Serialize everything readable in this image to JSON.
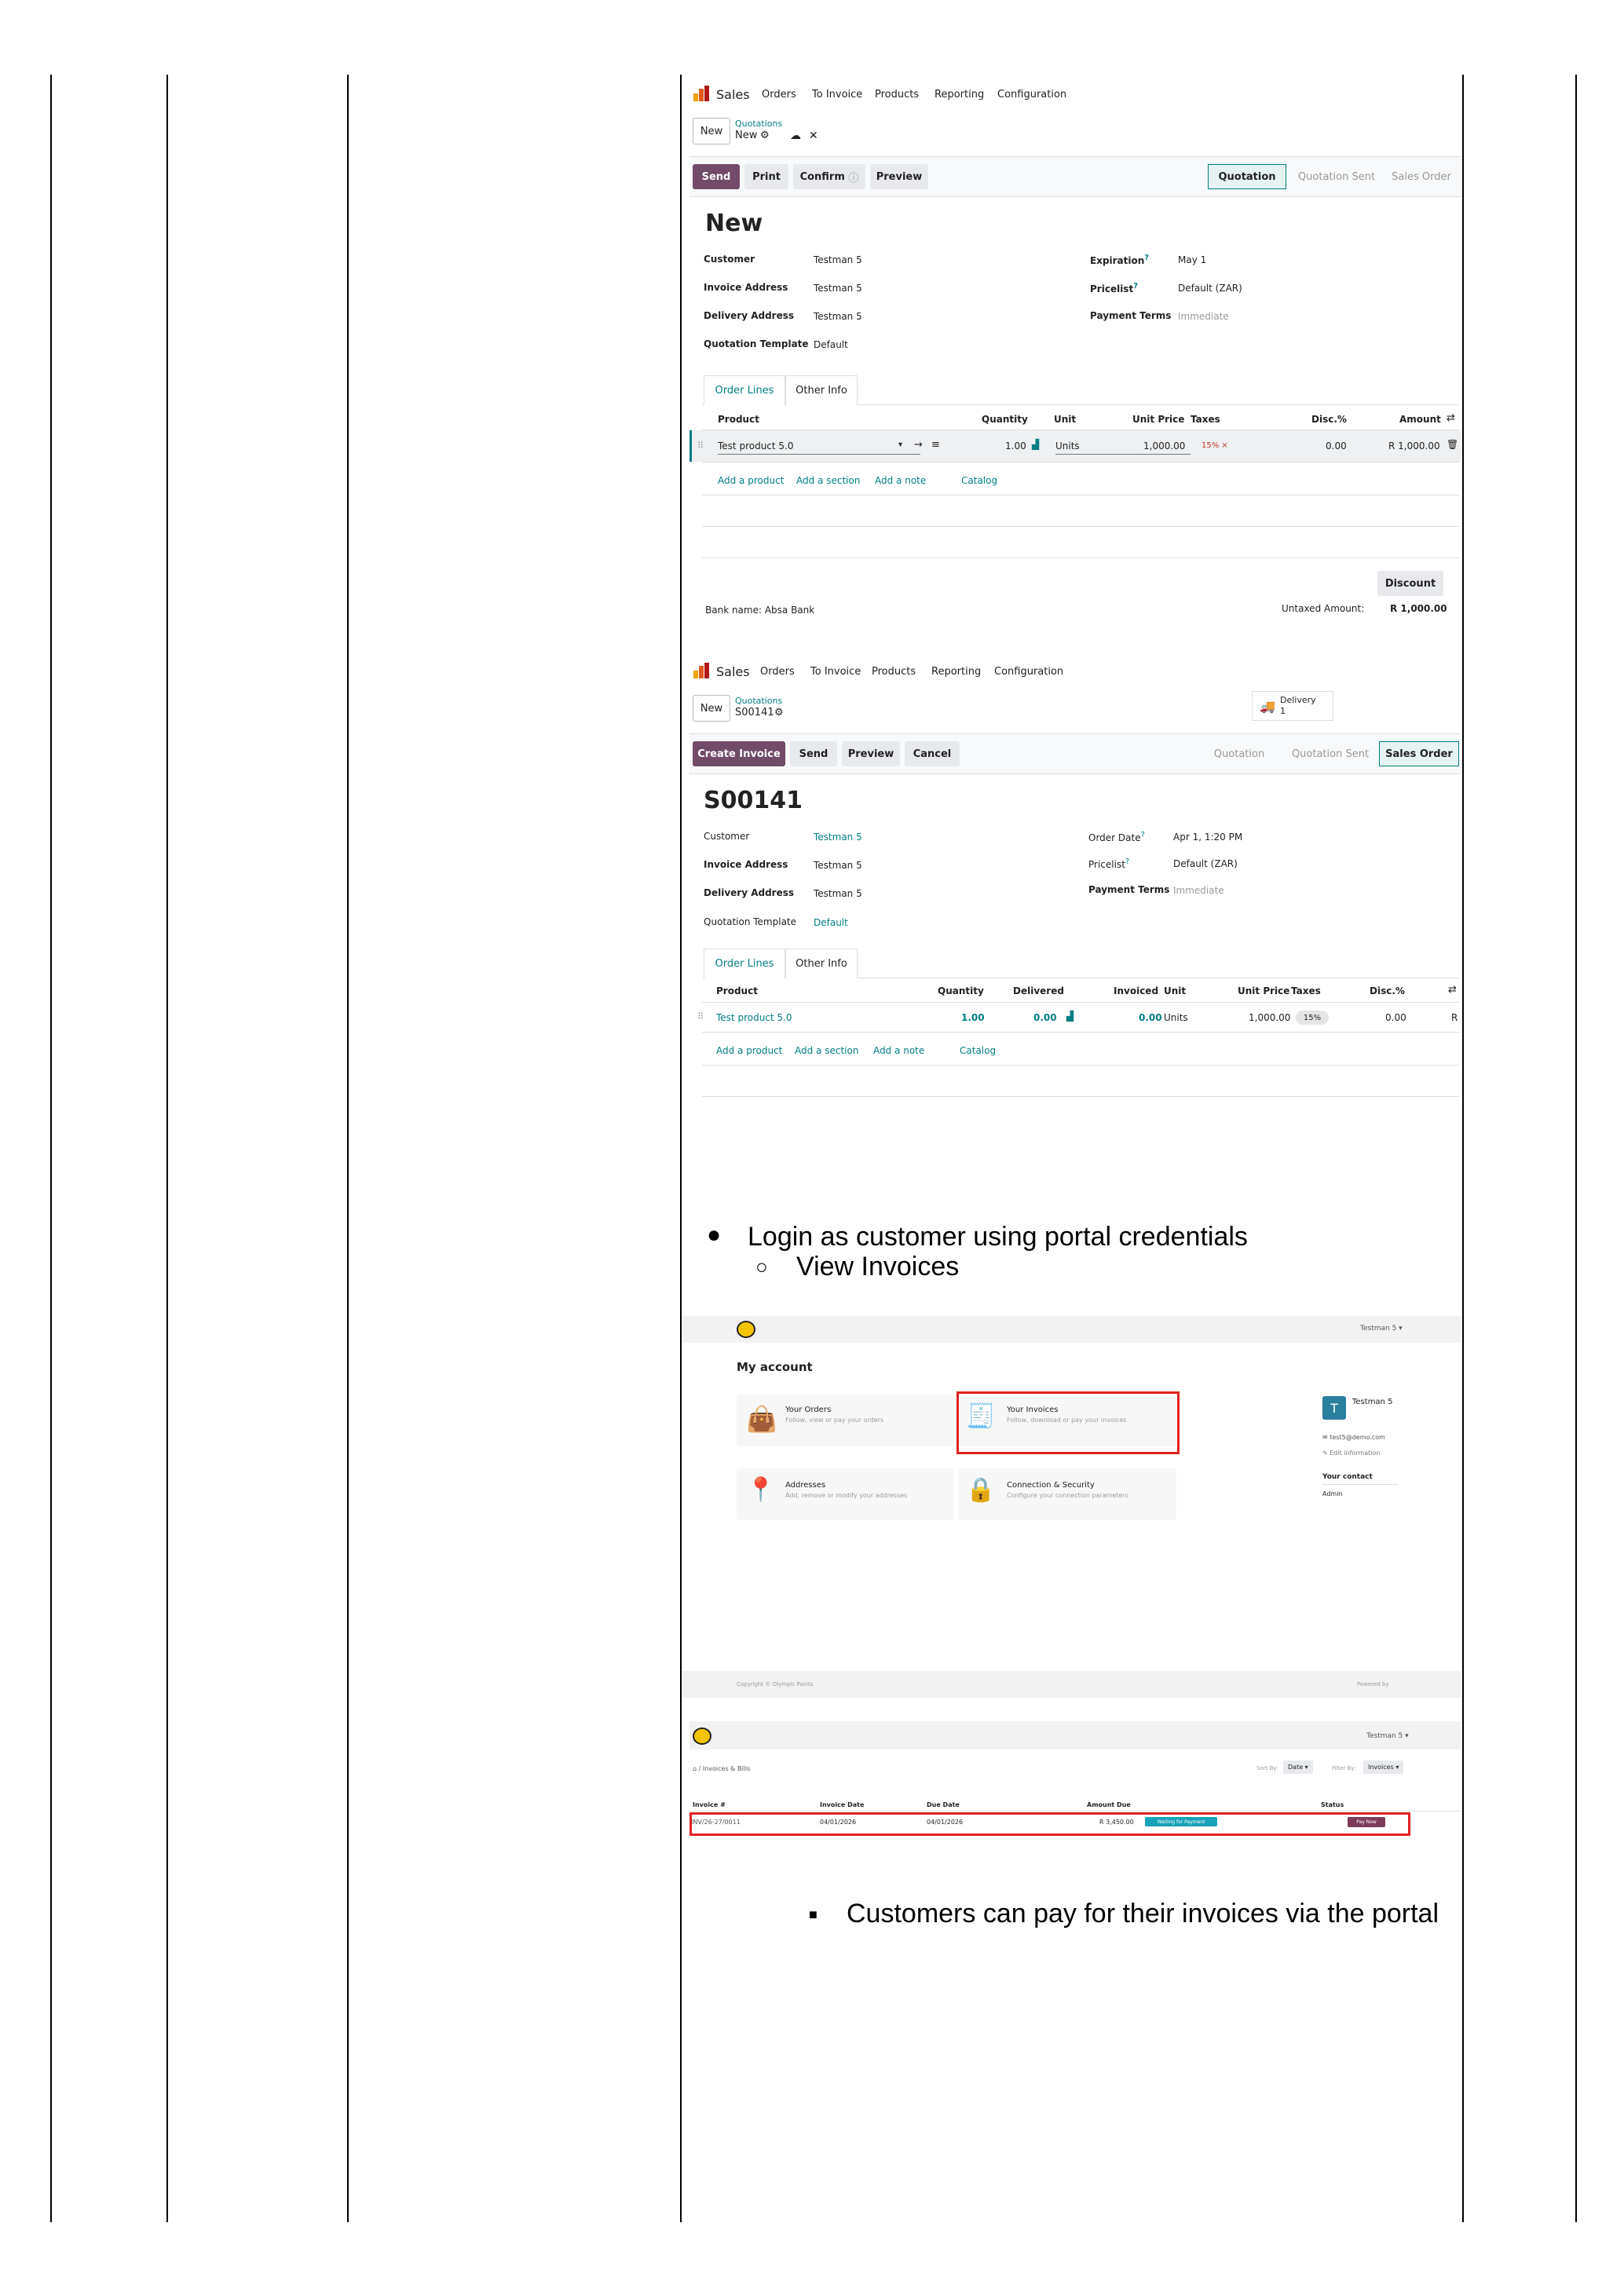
{
  "shot1": {
    "app": "Sales",
    "menu": [
      "Orders",
      "To Invoice",
      "Products",
      "Reporting",
      "Configuration"
    ],
    "new_button": "New",
    "breadcrumb_parent": "Quotations",
    "breadcrumb_current": "New",
    "actions": {
      "send": "Send",
      "print": "Print",
      "confirm": "Confirm",
      "preview": "Preview"
    },
    "stages": {
      "quotation": "Quotation",
      "sent": "Quotation Sent",
      "order": "Sales Order"
    },
    "record_title": "New",
    "fields": {
      "customer_label": "Customer",
      "customer": "Testman 5",
      "invoice_label": "Invoice Address",
      "invoice": "Testman 5",
      "delivery_label": "Delivery Address",
      "delivery": "Testman 5",
      "template_label": "Quotation Template",
      "template": "Default",
      "expiration_label": "Expiration",
      "expiration": "May 1",
      "pricelist_label": "Pricelist",
      "pricelist": "Default (ZAR)",
      "terms_label": "Payment Terms",
      "terms": "Immediate"
    },
    "tabs": {
      "order_lines": "Order Lines",
      "other_info": "Other Info"
    },
    "columns": {
      "product": "Product",
      "quantity": "Quantity",
      "unit": "Unit",
      "unit_price": "Unit Price",
      "taxes": "Taxes",
      "disc": "Disc.%",
      "amount": "Amount"
    },
    "line": {
      "product": "Test product 5.0",
      "quantity": "1.00",
      "unit": "Units",
      "unit_price": "1,000.00",
      "tax": "15% ×",
      "disc": "0.00",
      "amount": "R 1,000.00"
    },
    "links": {
      "add_product": "Add a product",
      "add_section": "Add a section",
      "add_note": "Add a note",
      "catalog": "Catalog"
    },
    "discount": "Discount",
    "bank_note": "Bank name: Absa Bank",
    "untaxed_label": "Untaxed Amount:",
    "untaxed": "R 1,000.00"
  },
  "shot2": {
    "app": "Sales",
    "menu": [
      "Orders",
      "To Invoice",
      "Products",
      "Reporting",
      "Configuration"
    ],
    "new_button": "New",
    "breadcrumb_parent": "Quotations",
    "breadcrumb_current": "S00141",
    "delivery_label": "Delivery",
    "delivery_count": "1",
    "actions": {
      "create_invoice": "Create Invoice",
      "send": "Send",
      "preview": "Preview",
      "cancel": "Cancel"
    },
    "stages": {
      "quotation": "Quotation",
      "sent": "Quotation Sent",
      "order": "Sales Order"
    },
    "record_title": "S00141",
    "fields": {
      "customer_label": "Customer",
      "customer": "Testman 5",
      "invoice_label": "Invoice Address",
      "invoice": "Testman 5",
      "delivery_label": "Delivery Address",
      "delivery": "Testman 5",
      "template_label": "Quotation Template",
      "template": "Default",
      "order_date_label": "Order Date",
      "order_date": "Apr 1, 1:20 PM",
      "pricelist_label": "Pricelist",
      "pricelist": "Default (ZAR)",
      "terms_label": "Payment Terms",
      "terms": "Immediate"
    },
    "tabs": {
      "order_lines": "Order Lines",
      "other_info": "Other Info"
    },
    "columns": {
      "product": "Product",
      "quantity": "Quantity",
      "delivered": "Delivered",
      "invoiced": "Invoiced",
      "unit": "Unit",
      "unit_price": "Unit Price",
      "taxes": "Taxes",
      "disc": "Disc.%"
    },
    "line": {
      "product": "Test product 5.0",
      "quantity": "1.00",
      "delivered": "0.00",
      "invoiced": "0.00",
      "unit": "Units",
      "unit_price": "1,000.00",
      "tax": "15%",
      "disc": "0.00",
      "amount": "R"
    },
    "links": {
      "add_product": "Add a product",
      "add_section": "Add a section",
      "add_note": "Add a note",
      "catalog": "Catalog"
    }
  },
  "bullet1": "Login as customer using portal credentials",
  "bullet1_sub": "View Invoices",
  "shot3": {
    "user": "Testman 5 ▾",
    "title": "My account",
    "cards": [
      {
        "title": "Your Orders",
        "desc": "Follow, view or pay your orders"
      },
      {
        "title": "Your Invoices",
        "desc": "Follow, download or pay your invoices"
      },
      {
        "title": "Addresses",
        "desc": "Add, remove or modify your addresses"
      },
      {
        "title": "Connection & Security",
        "desc": "Configure your connection parameters"
      }
    ],
    "profile_initial": "T",
    "profile_name": "Testman 5",
    "profile_email": "✉ test5@demo.com",
    "edit_info": "✎ Edit information",
    "contact_label": "Your contact",
    "contact_name": "Admin",
    "copyright": "Copyright © Olympic Paints",
    "powered": "Powered by"
  },
  "shot4": {
    "user": "Testman 5 ▾",
    "breadcrumb": "⌂ / Invoices & Bills",
    "sort_label": "Sort By:",
    "sort_value": "Date ▾",
    "filter_label": "Filter By:",
    "filter_value": "Invoices ▾",
    "columns": {
      "invoice": "Invoice #",
      "date": "Invoice Date",
      "due": "Due Date",
      "amount": "Amount Due",
      "status": "Status"
    },
    "row": {
      "invoice": "INV/26-27/0011",
      "date": "04/01/2026",
      "due": "04/01/2026",
      "amount": "R 3,450.00",
      "status": "Waiting for Payment",
      "pay": "Pay Now"
    }
  },
  "bullet2": "Customers can pay for their invoices via the portal"
}
